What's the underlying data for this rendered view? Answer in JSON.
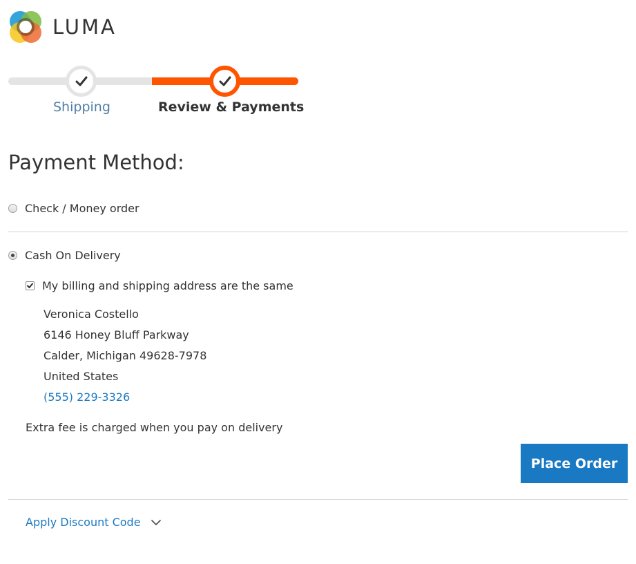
{
  "logo": {
    "text": "LUMA"
  },
  "progress": {
    "steps": [
      {
        "label": "Shipping",
        "state": "complete"
      },
      {
        "label": "Review & Payments",
        "state": "active"
      }
    ]
  },
  "payment": {
    "title": "Payment Method:",
    "methods": [
      {
        "label": "Check / Money order",
        "selected": false
      },
      {
        "label": "Cash On Delivery",
        "selected": true
      }
    ],
    "same_address_label": "My billing and shipping address are the same",
    "same_address_checked": true,
    "address": {
      "name": "Veronica Costello",
      "street": "6146 Honey Bluff Parkway",
      "city_line": "Calder, Michigan 49628-7978",
      "country": "United States",
      "phone": "(555) 229-3326"
    },
    "note": "Extra fee is charged when you pay on delivery",
    "place_order_label": "Place Order"
  },
  "discount": {
    "label": "Apply Discount Code"
  },
  "colors": {
    "accent_orange": "#ff5501",
    "primary_blue": "#1979c3",
    "link_blue": "#1979c3"
  }
}
